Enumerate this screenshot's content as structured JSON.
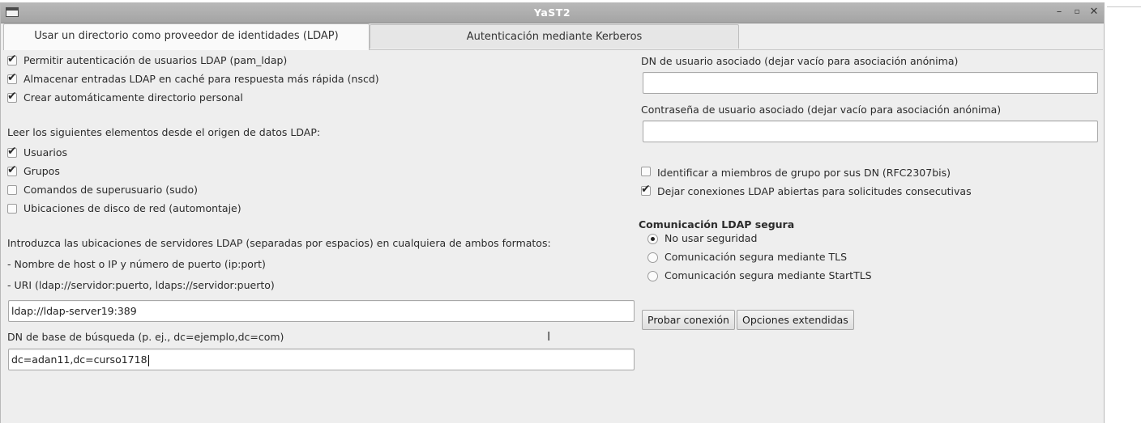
{
  "window": {
    "title": "YaST2"
  },
  "tabs": [
    {
      "label": "Usar un directorio como proveedor de identidades (LDAP)",
      "active": true
    },
    {
      "label": "Autenticación mediante Kerberos",
      "active": false
    }
  ],
  "left": {
    "options": [
      {
        "label": "Permitir autenticación de usuarios LDAP (pam_ldap)",
        "checked": true
      },
      {
        "label": "Almacenar entradas LDAP en caché para respuesta más rápida (nscd)",
        "checked": true
      },
      {
        "label": "Crear automáticamente directorio personal",
        "checked": true
      }
    ],
    "read_heading": "Leer los siguientes elementos desde el origen de datos LDAP:",
    "read_items": [
      {
        "label": "Usuarios",
        "checked": true
      },
      {
        "label": "Grupos",
        "checked": true
      },
      {
        "label": "Comandos de superusuario (sudo)",
        "checked": false
      },
      {
        "label": "Ubicaciones de disco de red (automontaje)",
        "checked": false
      }
    ],
    "servers_intro": "Introduzca las ubicaciones de servidores LDAP (separadas por espacios) en cualquiera de ambos formatos:",
    "servers_format1": "- Nombre de host o IP y número de puerto (ip:port)",
    "servers_format2": "- URI (ldap://servidor:puerto, ldaps://servidor:puerto)",
    "servers_value": "ldap://ldap-server19:389",
    "base_dn_label": "DN de base de búsqueda (p. ej., dc=ejemplo,dc=com)",
    "base_dn_value": "dc=adan11,dc=curso1718"
  },
  "right": {
    "bind_dn_label": "DN de usuario asociado (dejar vacío para asociación anónima)",
    "bind_dn_value": "",
    "bind_pw_label": "Contraseña de usuario asociado (dejar vacío para asociación anónima)",
    "bind_pw_value": "",
    "options": [
      {
        "label": "Identificar a miembros de grupo por sus DN (RFC2307bis)",
        "checked": false
      },
      {
        "label": "Dejar conexiones LDAP abiertas para solicitudes consecutivas",
        "checked": true
      }
    ],
    "secure_heading": "Comunicación LDAP segura",
    "secure_options": [
      {
        "label": "No usar seguridad",
        "selected": true
      },
      {
        "label": "Comunicación segura mediante TLS",
        "selected": false
      },
      {
        "label": "Comunicación segura mediante StartTLS",
        "selected": false
      }
    ],
    "test_button": "Probar conexión",
    "extended_button": "Opciones extendidas"
  }
}
